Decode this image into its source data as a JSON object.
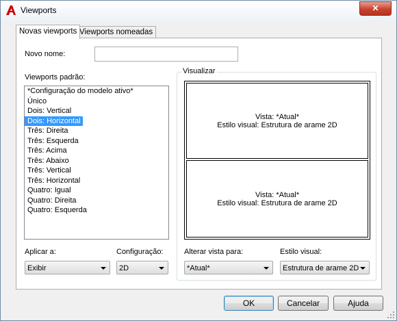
{
  "window": {
    "title": "Viewports",
    "close_symbol": "✕"
  },
  "tabs": [
    {
      "label": "Novas viewports",
      "active": true
    },
    {
      "label": "Viewports nomeadas",
      "active": false
    }
  ],
  "new_name": {
    "label": "Novo nome:",
    "value": ""
  },
  "standard_viewports": {
    "label": "Viewports padrão:",
    "items": [
      "*Configuração do modelo ativo*",
      "Único",
      "Dois: Vertical",
      "Dois: Horizontal",
      "Três: Direita",
      "Três: Esquerda",
      "Três: Acima",
      "Três: Abaixo",
      "Três: Vertical",
      "Três: Horizontal",
      "Quatro:  Igual",
      "Quatro:  Direita",
      "Quatro:  Esquerda"
    ],
    "selected": "Dois: Horizontal"
  },
  "preview": {
    "label": "Visualizar",
    "panes": [
      {
        "view": "Vista: *Atual*",
        "visual_style": "Estilo visual: Estrutura de arame 2D"
      },
      {
        "view": "Vista: *Atual*",
        "visual_style": "Estilo visual: Estrutura de arame 2D"
      }
    ]
  },
  "apply_to": {
    "label": "Aplicar a:",
    "value": "Exibir"
  },
  "setup": {
    "label": "Configuração:",
    "value": "2D"
  },
  "change_view": {
    "label": "Alterar vista para:",
    "value": "*Atual*"
  },
  "visual_style": {
    "label": "Estilo visual:",
    "value": "Estrutura de arame 2D"
  },
  "buttons": {
    "ok": "OK",
    "cancel": "Cancelar",
    "help": "Ajuda"
  },
  "colors": {
    "selection": "#3399ff",
    "close_button": "#c7432f",
    "app_icon": "#cc0000"
  }
}
